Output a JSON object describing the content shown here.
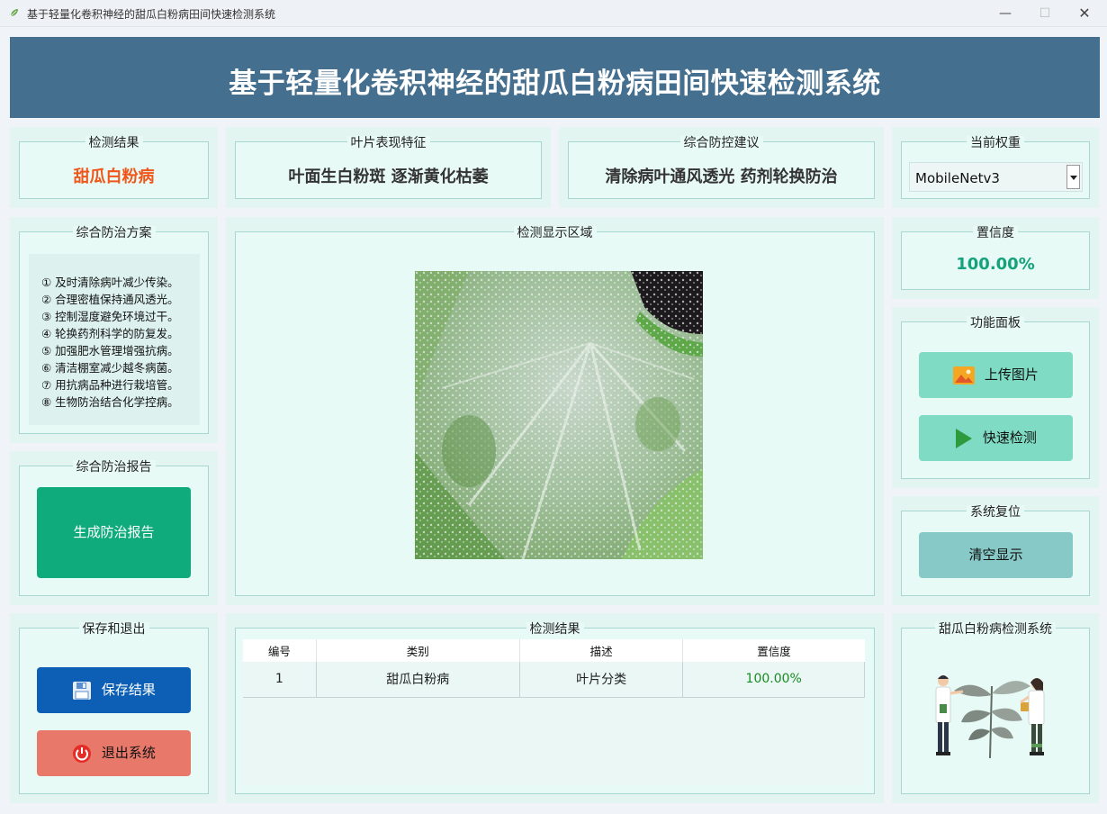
{
  "window": {
    "title": "基于轻量化卷积神经的甜瓜白粉病田间快速检测系统",
    "minimize": "—",
    "maximize": "☐",
    "close": "✕"
  },
  "header": {
    "title": "基于轻量化卷积神经的甜瓜白粉病田间快速检测系统"
  },
  "detection": {
    "label": "检测结果",
    "value": "甜瓜白粉病"
  },
  "leaf": {
    "label": "叶片表现特征",
    "value": "叶面生白粉斑 逐渐黄化枯萎"
  },
  "advice": {
    "label": "综合防控建议",
    "value": "清除病叶通风透光 药剂轮换防治"
  },
  "weight": {
    "label": "当前权重",
    "selected": "MobileNetv3"
  },
  "confidence": {
    "label": "置信度",
    "value": "100.00%"
  },
  "plan": {
    "label": "综合防治方案",
    "items": [
      "① 及时清除病叶减少传染。",
      "② 合理密植保持通风透光。",
      "③ 控制湿度避免环境过干。",
      "④ 轮换药剂科学的防复发。",
      "⑤ 加强肥水管理增强抗病。",
      "⑥ 清洁棚室减少越冬病菌。",
      "⑦ 用抗病品种进行栽培管。",
      "⑧ 生物防治结合化学控病。"
    ]
  },
  "display": {
    "label": "检测显示区域"
  },
  "report": {
    "label": "综合防治报告",
    "button": "生成防治报告"
  },
  "functions": {
    "label": "功能面板",
    "upload": "上传图片",
    "detect": "快速检测"
  },
  "reset": {
    "label": "系统复位",
    "clear": "清空显示"
  },
  "save_exit": {
    "label": "保存和退出",
    "save": "保存结果",
    "exit": "退出系统"
  },
  "results": {
    "label": "检测结果",
    "columns": [
      "编号",
      "类别",
      "描述",
      "置信度"
    ],
    "rows": [
      [
        "1",
        "甜瓜白粉病",
        "叶片分类",
        "100.00%"
      ]
    ]
  },
  "about": {
    "label": "甜瓜白粉病检测系统"
  },
  "colors": {
    "header": "#456f8f",
    "detection_value": "#f0561a",
    "confidence_value": "#13a27c",
    "report_button": "#10ab7c",
    "function_button": "#7fdbc3",
    "clear_button": "#87c9c7",
    "save_button": "#0d5fb5",
    "exit_button": "#e8796a",
    "result_confidence": "#1a8a22"
  }
}
